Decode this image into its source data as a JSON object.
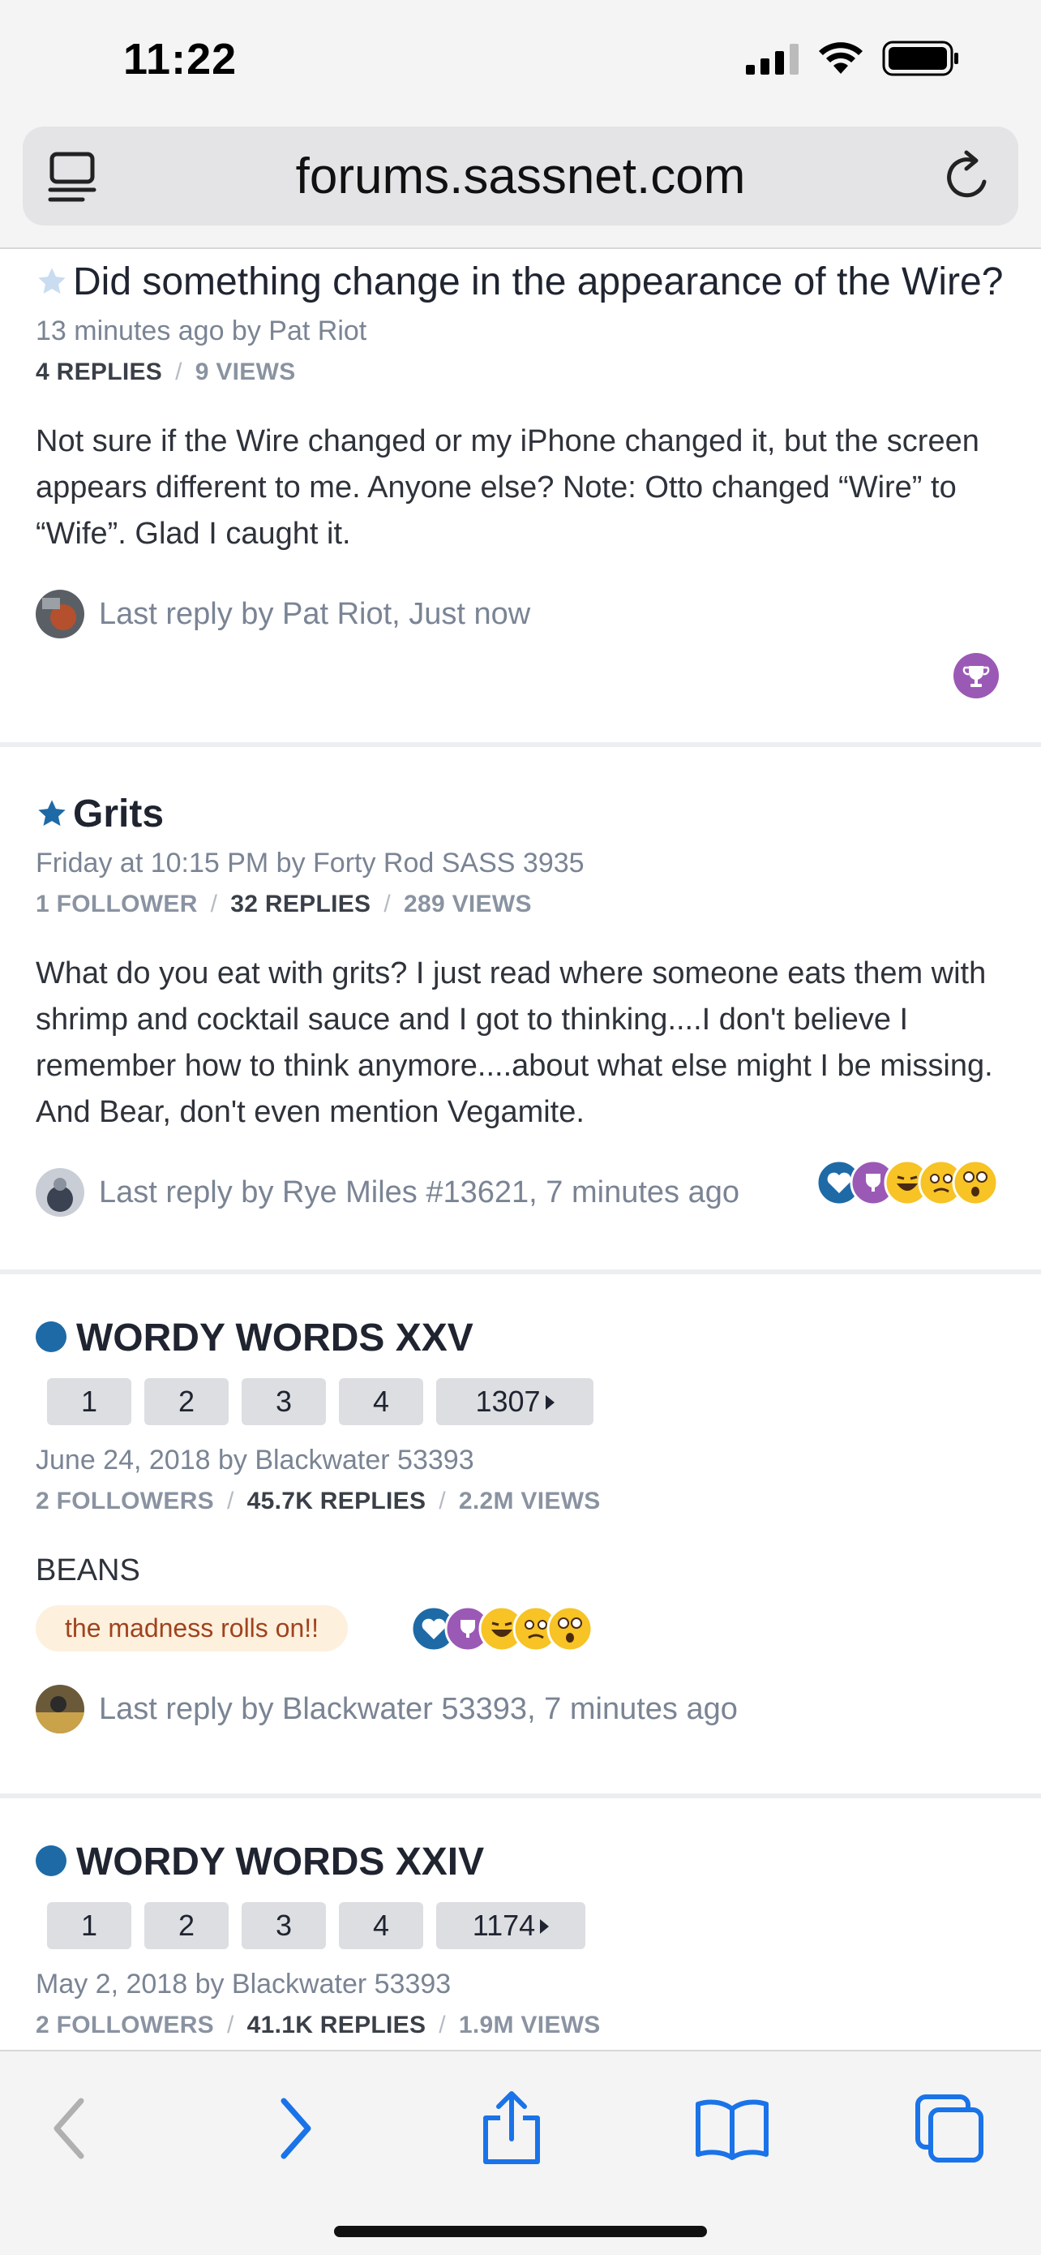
{
  "status_bar": {
    "time": "11:22"
  },
  "browser": {
    "url": "forums.sassnet.com"
  },
  "threads": [
    {
      "title": "Did something change in the appearance of the Wire?",
      "meta": "13 minutes ago by Pat Riot",
      "replies": "4 REPLIES",
      "views": "9 VIEWS",
      "excerpt": "Not sure if the Wire changed or my iPhone changed it, but the screen appears different to me. Anyone else? Note: Otto changed “Wire” to “Wife”. Glad I caught it.",
      "last_reply": "Last reply by Pat Riot, Just now"
    },
    {
      "title": "Grits",
      "meta": "Friday at 10:15 PM by Forty Rod SASS 3935",
      "followers": "1 FOLLOWER",
      "replies": "32 REPLIES",
      "views": "289 VIEWS",
      "excerpt": "What do you eat with grits? I just read where someone eats them with shrimp and cocktail sauce and I got to thinking....I don't believe I remember how to think anymore....about what else might I be missing. And Bear, don't even mention Vegamite.",
      "last_reply": "Last reply by Rye Miles #13621, 7 minutes ago"
    },
    {
      "title": "WORDY WORDS XXV",
      "pages": [
        "1",
        "2",
        "3",
        "4",
        "1307"
      ],
      "meta": "June 24, 2018 by Blackwater 53393",
      "followers": "2 FOLLOWERS",
      "replies": "45.7K REPLIES",
      "views": "2.2M VIEWS",
      "excerpt": "BEANS",
      "tag": "the madness rolls on!!",
      "last_reply": "Last reply by Blackwater 53393, 7 minutes ago"
    },
    {
      "title": "WORDY WORDS XXIV",
      "pages": [
        "1",
        "2",
        "3",
        "4",
        "1174"
      ],
      "meta": "May 2, 2018 by Blackwater 53393",
      "followers": "2 FOLLOWERS",
      "replies": "41.1K REPLIES",
      "views": "1.9M VIEWS"
    }
  ],
  "icons": {
    "status": [
      "signal-icon",
      "wifi-icon",
      "battery-icon"
    ],
    "browser": [
      "reader-mode-icon",
      "reload-icon"
    ],
    "toolbar": [
      "back-icon",
      "forward-icon",
      "share-icon",
      "bookmarks-icon",
      "tabs-icon"
    ]
  },
  "colors": {
    "accent_blue": "#1e6aa6",
    "safari_blue": "#1a73e8",
    "meta_gray": "#7a8494",
    "tag_bg": "#fdf0dd",
    "tag_text": "#a0431e",
    "trophy_purple": "#9b59b6"
  }
}
